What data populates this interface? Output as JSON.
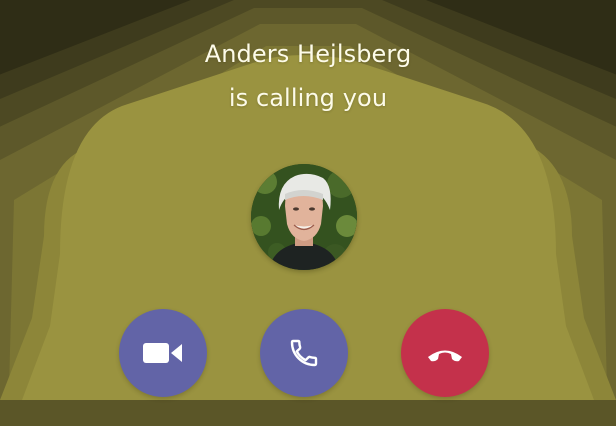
{
  "incoming_call": {
    "caller_name": "Anders Hejlsberg",
    "status_text": "is calling you"
  },
  "avatar": {
    "icon": "caller-photo"
  },
  "actions": {
    "video": {
      "icon": "video-camera-icon",
      "color": "#6264a7"
    },
    "audio": {
      "icon": "phone-icon",
      "color": "#6264a7"
    },
    "decline": {
      "icon": "hang-up-icon",
      "color": "#c4314b"
    }
  },
  "colors": {
    "background_dark": "#2f2d16",
    "background_mid": "#7c7632",
    "background_light": "#a19a45",
    "text": "#fdfbe9"
  }
}
